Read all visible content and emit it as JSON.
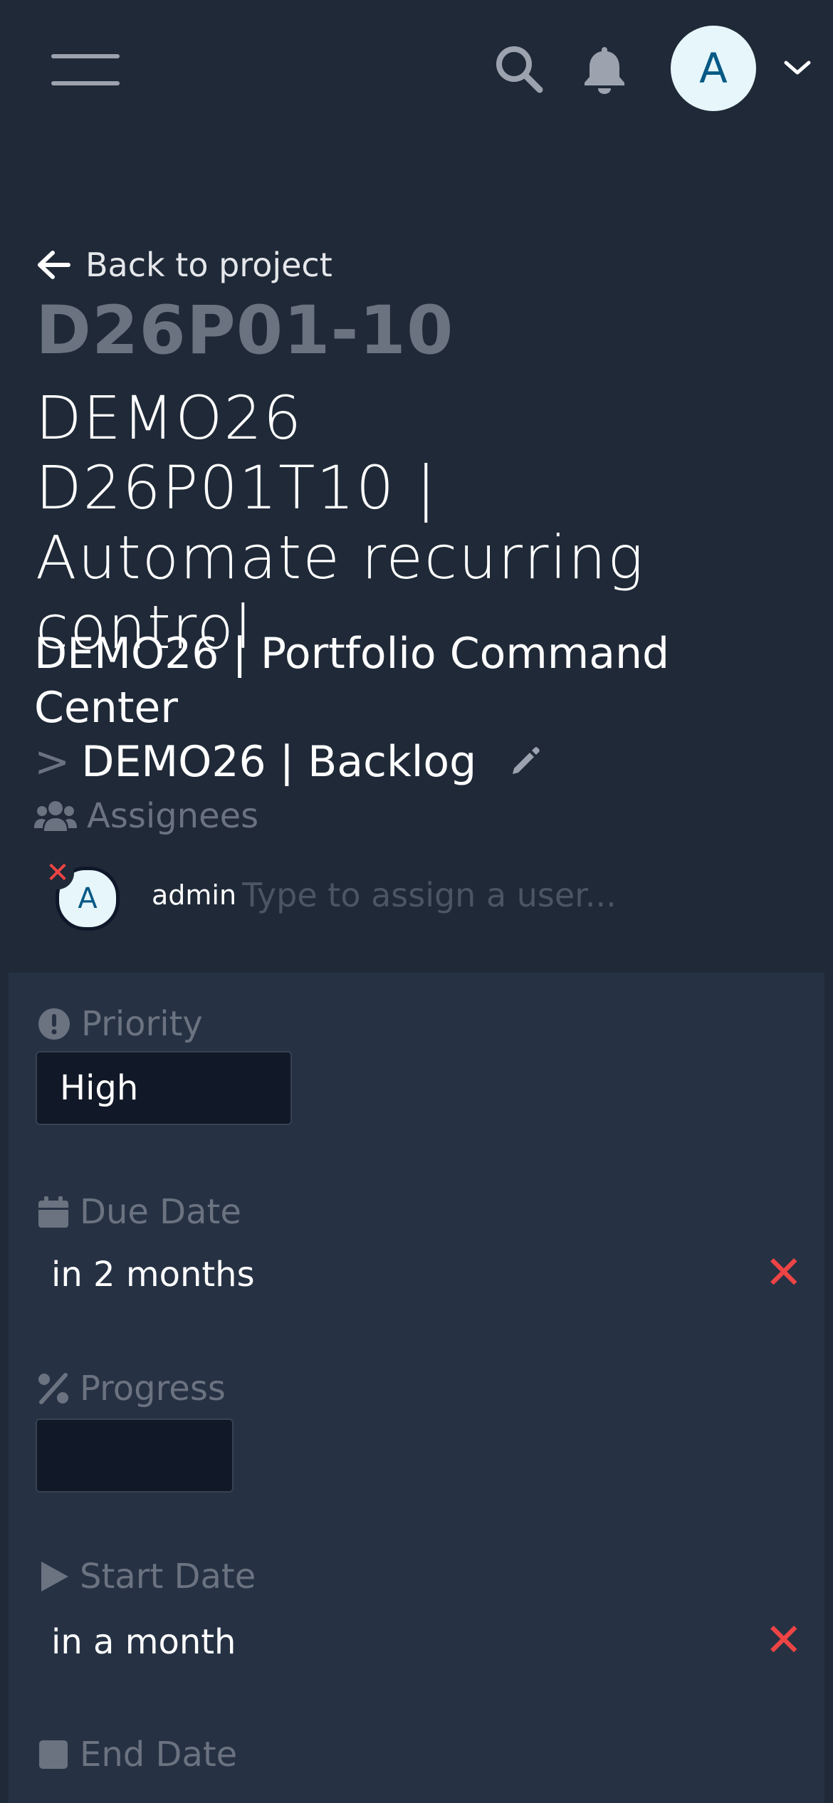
{
  "header": {
    "menu_icon": "hamburger-icon",
    "search_icon": "search-icon",
    "notifications_icon": "bell-icon",
    "avatar_initial": "A",
    "avatar_menu_icon": "chevron-down-icon"
  },
  "back_link": {
    "label": "Back to project",
    "icon": "arrow-left-icon"
  },
  "task": {
    "id": "D26P01-10",
    "title": "DEMO26 D26P01T10 | Automate recurring control"
  },
  "breadcrumb": {
    "project": "DEMO26 | Portfolio Command Center",
    "separator": ">",
    "list": "DEMO26 | Backlog",
    "edit_icon": "pencil-icon"
  },
  "assignees": {
    "label": "Assignees",
    "icon": "users-icon",
    "items": [
      {
        "initial": "A",
        "name": "admin",
        "remove_symbol": "✕"
      }
    ],
    "input_placeholder": "Type to assign a user..."
  },
  "fields": {
    "priority": {
      "label": "Priority",
      "icon": "exclamation-circle-icon",
      "value": "High"
    },
    "due_date": {
      "label": "Due Date",
      "icon": "calendar-icon",
      "value": "in 2 months",
      "clear_symbol": "✕"
    },
    "progress": {
      "label": "Progress",
      "icon": "percent-icon",
      "value": ""
    },
    "start_date": {
      "label": "Start Date",
      "icon": "play-icon",
      "value": "in a month",
      "clear_symbol": "✕"
    },
    "end_date": {
      "label": "End Date",
      "icon": "square-icon"
    }
  },
  "colors": {
    "background": "#1f2937",
    "panel": "#263244",
    "muted": "#6b7280",
    "danger": "#ef4444",
    "avatar_bg": "#e6f6fb",
    "avatar_text": "#075985"
  }
}
